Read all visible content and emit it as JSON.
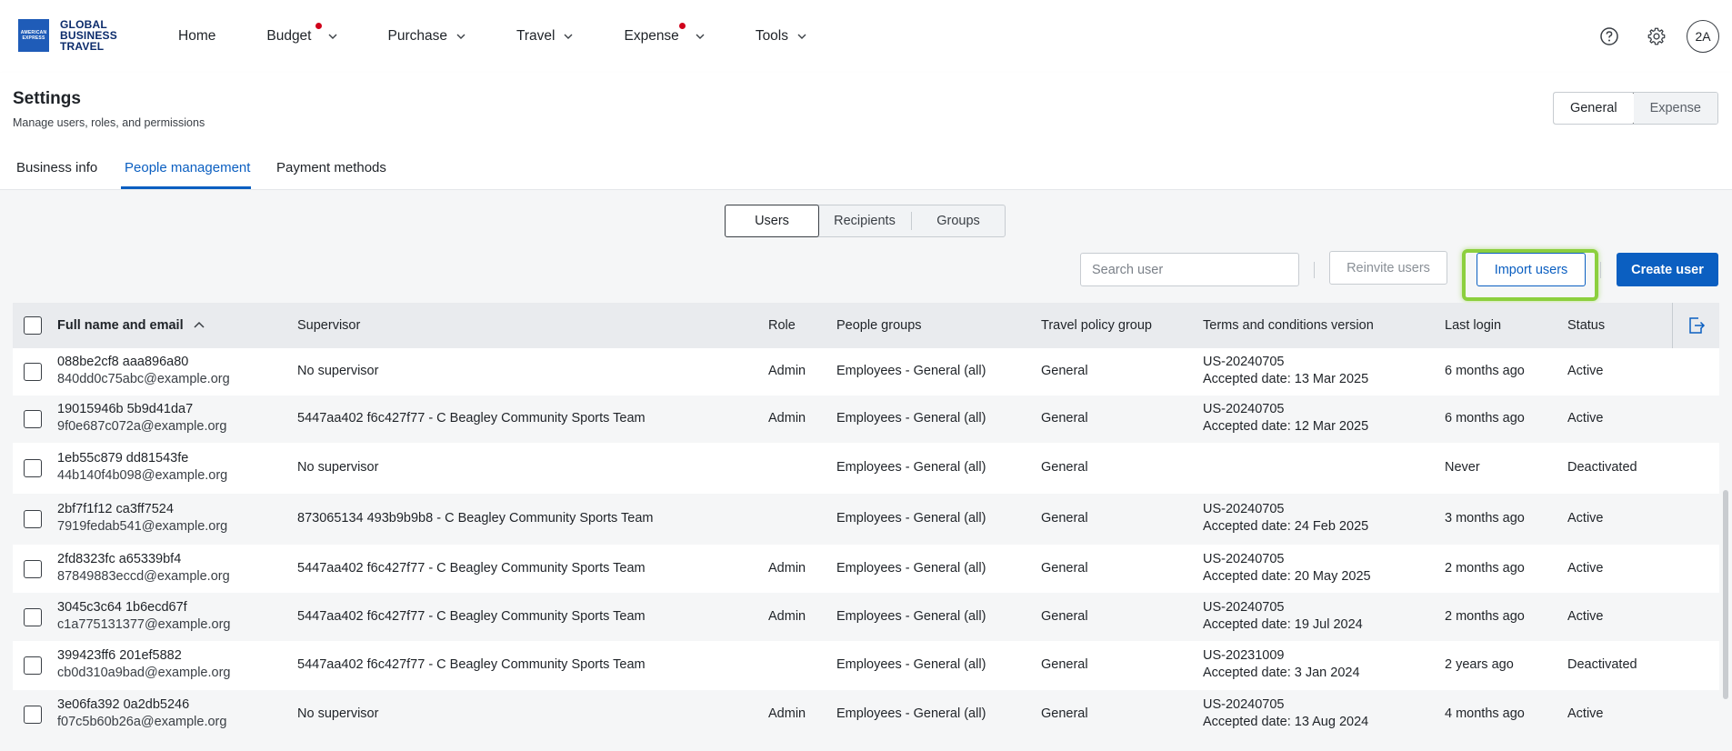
{
  "logo": {
    "box_line1": "AMERICAN",
    "box_line2": "EXPRESS",
    "line1": "GLOBAL",
    "line2": "BUSINESS",
    "line3": "TRAVEL"
  },
  "nav": {
    "items": [
      {
        "label": "Home",
        "dropdown": false,
        "notification": false
      },
      {
        "label": "Budget",
        "dropdown": true,
        "notification": true
      },
      {
        "label": "Purchase",
        "dropdown": true,
        "notification": false
      },
      {
        "label": "Travel",
        "dropdown": true,
        "notification": false
      },
      {
        "label": "Expense",
        "dropdown": true,
        "notification": true
      },
      {
        "label": "Tools",
        "dropdown": true,
        "notification": false
      }
    ],
    "avatar": "2A"
  },
  "header": {
    "title": "Settings",
    "subtitle": "Manage users, roles, and permissions",
    "modes": [
      "General",
      "Expense"
    ],
    "active_mode": "General"
  },
  "tabs": [
    {
      "label": "Business info"
    },
    {
      "label": "People management"
    },
    {
      "label": "Payment methods"
    }
  ],
  "segments": [
    "Users",
    "Recipients",
    "Groups"
  ],
  "toolbar": {
    "search_placeholder": "Search user",
    "reinvite_label": "Reinvite users",
    "import_label": "Import users",
    "create_label": "Create user"
  },
  "table": {
    "headers": [
      "Full name and email",
      "Supervisor",
      "Role",
      "People groups",
      "Travel policy group",
      "Terms and conditions version",
      "Last login",
      "Status"
    ],
    "rows": [
      {
        "name": "088be2cf8 aaa896a80",
        "email": "840dd0c75abc@example.org",
        "supervisor": "No supervisor",
        "role": "Admin",
        "groups": "Employees - General (all)",
        "policy": "General",
        "terms": "US-20240705",
        "accepted": "Accepted date: 13 Mar 2025",
        "last_login": "6 months ago",
        "status": "Active"
      },
      {
        "name": "19015946b 5b9d41da7",
        "email": "9f0e687c072a@example.org",
        "supervisor": "5447aa402 f6c427f77 - C Beagley Community Sports Team",
        "role": "Admin",
        "groups": "Employees - General (all)",
        "policy": "General",
        "terms": "US-20240705",
        "accepted": "Accepted date: 12 Mar 2025",
        "last_login": "6 months ago",
        "status": "Active"
      },
      {
        "name": "1eb55c879 dd81543fe",
        "email": "44b140f4b098@example.org",
        "supervisor": "No supervisor",
        "role": "",
        "groups": "Employees - General (all)",
        "policy": "General",
        "terms": "",
        "accepted": "",
        "last_login": "Never",
        "status": "Deactivated"
      },
      {
        "name": "2bf7f1f12 ca3ff7524",
        "email": "7919fedab541@example.org",
        "supervisor": "873065134 493b9b9b8 - C Beagley Community Sports Team",
        "role": "",
        "groups": "Employees - General (all)",
        "policy": "General",
        "terms": "US-20240705",
        "accepted": "Accepted date: 24 Feb 2025",
        "last_login": "3 months ago",
        "status": "Active"
      },
      {
        "name": "2fd8323fc a65339bf4",
        "email": "87849883eccd@example.org",
        "supervisor": "5447aa402 f6c427f77 - C Beagley Community Sports Team",
        "role": "Admin",
        "groups": "Employees - General (all)",
        "policy": "General",
        "terms": "US-20240705",
        "accepted": "Accepted date: 20 May 2025",
        "last_login": "2 months ago",
        "status": "Active"
      },
      {
        "name": "3045c3c64 1b6ecd67f",
        "email": "c1a775131377@example.org",
        "supervisor": "5447aa402 f6c427f77 - C Beagley Community Sports Team",
        "role": "Admin",
        "groups": "Employees - General (all)",
        "policy": "General",
        "terms": "US-20240705",
        "accepted": "Accepted date: 19 Jul 2024",
        "last_login": "2 months ago",
        "status": "Active"
      },
      {
        "name": "399423ff6 201ef5882",
        "email": "cb0d310a9bad@example.org",
        "supervisor": "5447aa402 f6c427f77 - C Beagley Community Sports Team",
        "role": "",
        "groups": "Employees - General (all)",
        "policy": "General",
        "terms": "US-20231009",
        "accepted": "Accepted date: 3 Jan 2024",
        "last_login": "2 years ago",
        "status": "Deactivated"
      },
      {
        "name": "3e06fa392 0a2db5246",
        "email": "f07c5b60b26a@example.org",
        "supervisor": "No supervisor",
        "role": "Admin",
        "groups": "Employees - General (all)",
        "policy": "General",
        "terms": "US-20240705",
        "accepted": "Accepted date: 13 Aug 2024",
        "last_login": "4 months ago",
        "status": "Active"
      }
    ]
  },
  "colors": {
    "accent": "#0b5fc1",
    "notification": "#d0021b",
    "highlight": "#8ccf3e"
  }
}
